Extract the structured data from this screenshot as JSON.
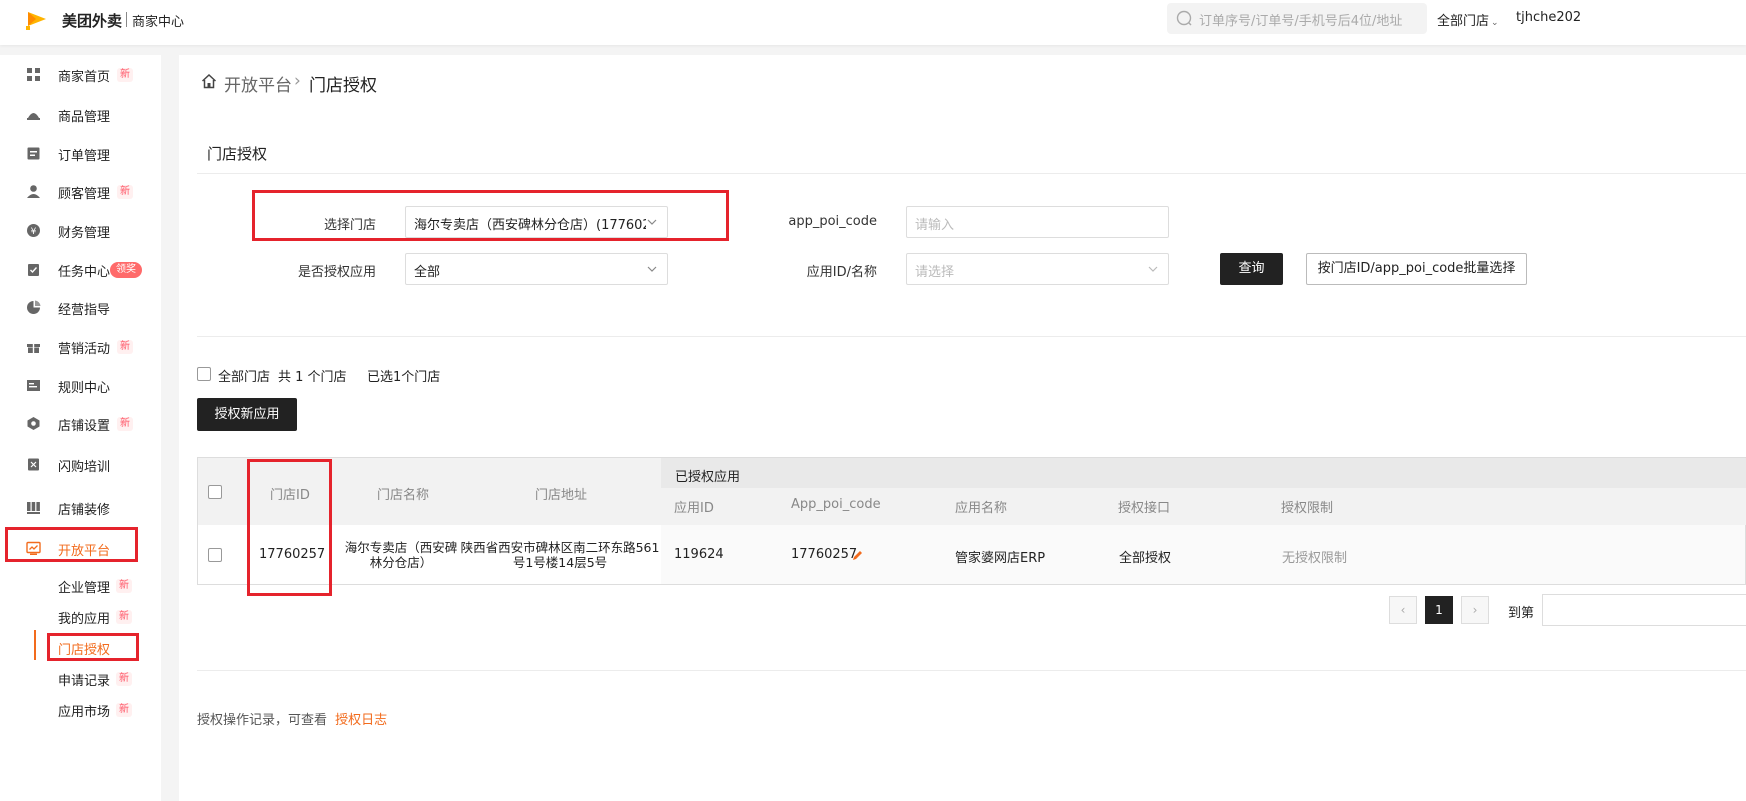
{
  "header": {
    "brand": "美团外卖",
    "brand_sub": "商家中心",
    "search_placeholder": "订单序号/订单号/手机号后4位/地址",
    "store_selector": "全部门店",
    "username": "tjhche202"
  },
  "sidebar": {
    "items": [
      {
        "label": "商家首页",
        "badge": "新",
        "icon": "dashboard-icon"
      },
      {
        "label": "商品管理",
        "badge": "",
        "icon": "goods-icon"
      },
      {
        "label": "订单管理",
        "badge": "",
        "icon": "order-icon"
      },
      {
        "label": "顾客管理",
        "badge": "新",
        "icon": "customer-icon"
      },
      {
        "label": "财务管理",
        "badge": "",
        "icon": "finance-icon"
      },
      {
        "label": "任务中心",
        "badge": "领奖",
        "icon": "task-icon"
      },
      {
        "label": "经营指导",
        "badge": "",
        "icon": "pie-icon"
      },
      {
        "label": "营销活动",
        "badge": "新",
        "icon": "gift-icon"
      },
      {
        "label": "规则中心",
        "badge": "",
        "icon": "rules-icon"
      },
      {
        "label": "店铺设置",
        "badge": "新",
        "icon": "store-settings-icon"
      },
      {
        "label": "闪购培训",
        "badge": "",
        "icon": "training-icon"
      },
      {
        "label": "店铺装修",
        "badge": "",
        "icon": "decorate-icon"
      },
      {
        "label": "开放平台",
        "badge": "",
        "icon": "open-platform-icon"
      }
    ],
    "sub_items": [
      {
        "label": "企业管理",
        "badge": "新"
      },
      {
        "label": "我的应用",
        "badge": "新"
      },
      {
        "label": "门店授权",
        "badge": ""
      },
      {
        "label": "申请记录",
        "badge": "新"
      },
      {
        "label": "应用市场",
        "badge": "新"
      }
    ]
  },
  "breadcrumb": {
    "parent": "开放平台",
    "separator": "›",
    "current": "门店授权"
  },
  "section_title": "门店授权",
  "filters": {
    "store_label": "选择门店",
    "store_value": "海尔专卖店（西安碑林分仓店）(177602",
    "poi_code_label": "app_poi_code",
    "poi_code_placeholder": "请输入",
    "authorized_label": "是否授权应用",
    "authorized_value": "全部",
    "app_label": "应用ID/名称",
    "app_placeholder": "请选择",
    "query_button": "查询",
    "batch_button": "按门店ID/app_poi_code批量选择"
  },
  "selection": {
    "all_label": "全部门店",
    "total_text": "共 1 个门店",
    "selected_text": "已选1个门店",
    "authorize_button": "授权新应用"
  },
  "table": {
    "headers": {
      "store_id": "门店ID",
      "store_name": "门店名称",
      "store_address": "门店地址",
      "authorized_apps": "已授权应用",
      "app_id": "应用ID",
      "app_poi_code": "App_poi_code",
      "app_name": "应用名称",
      "auth_interface": "授权接口",
      "auth_limit": "授权限制"
    },
    "rows": [
      {
        "store_id": "17760257",
        "store_name_line1": "海尔专卖店（西安碑",
        "store_name_line2": "林分仓店）",
        "address_line1": "陕西省西安市碑林区南二环东路561",
        "address_line2": "号1号楼14层5号",
        "app_id": "119624",
        "app_poi_code": "17760257",
        "app_name": "管家婆网店ERP",
        "auth_interface": "全部授权",
        "auth_limit": "无授权限制"
      }
    ]
  },
  "pagination": {
    "prev": "‹",
    "current": "1",
    "next": "›",
    "goto_label": "到第"
  },
  "footer": {
    "text": "授权操作记录，可查看",
    "link": "授权日志"
  },
  "colors": {
    "accent": "#f26b1d",
    "highlight_box": "#e5232c",
    "dark_button": "#222222"
  }
}
